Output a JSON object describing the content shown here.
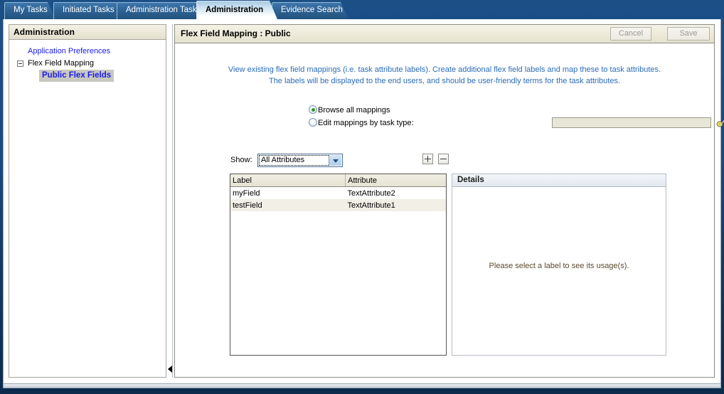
{
  "window": {
    "tabs": [
      {
        "label": "My Tasks",
        "active": false
      },
      {
        "label": "Initiated Tasks",
        "active": false
      },
      {
        "label": "Administration Tasks",
        "active": false
      },
      {
        "label": "Administration",
        "active": true
      },
      {
        "label": "Evidence Search",
        "active": false
      }
    ]
  },
  "sidebar": {
    "title": "Administration",
    "items": [
      {
        "label": "Application Preferences",
        "type": "link"
      },
      {
        "label": "Flex Field Mapping",
        "type": "branch",
        "expander": "minus-box"
      },
      {
        "label": "Public Flex Fields",
        "type": "selected-link"
      }
    ]
  },
  "main": {
    "title": "Flex Field Mapping : Public",
    "buttons": {
      "cancel": "Cancel",
      "save": "Save"
    },
    "instructions": {
      "line1": "View existing flex field mappings (i.e. task attribute labels). Create additional flex field labels and map these to task attributes.",
      "line2": "The labels will be displayed to the end users, and should be user-friendly terms for the task attributes."
    },
    "radios": [
      {
        "label": "Browse all mappings",
        "checked": true
      },
      {
        "label": "Edit mappings by task type:",
        "checked": false
      }
    ],
    "task_type_field": {
      "value": "",
      "placeholder": ""
    },
    "flashlight_icon": "flashlight-icon",
    "show": {
      "label": "Show:",
      "selected": "All Attributes",
      "options": [
        "All Attributes"
      ]
    },
    "add_button_icon": "plus-icon",
    "remove_button_icon": "minus-icon",
    "table": {
      "columns": [
        "Label",
        "Attribute"
      ],
      "rows": [
        {
          "label": "myField",
          "attribute": "TextAttribute2"
        },
        {
          "label": "testField",
          "attribute": "TextAttribute1"
        }
      ]
    },
    "details": {
      "title": "Details",
      "empty_message": "Please select a label to see its usage(s)."
    }
  },
  "colors": {
    "chrome_blue": "#1b4f86",
    "link_blue": "#1a1aee",
    "instruction_blue": "#2b6cb8",
    "header_cream": "#ebe8d8",
    "radio_green": "#2a9d2a"
  }
}
